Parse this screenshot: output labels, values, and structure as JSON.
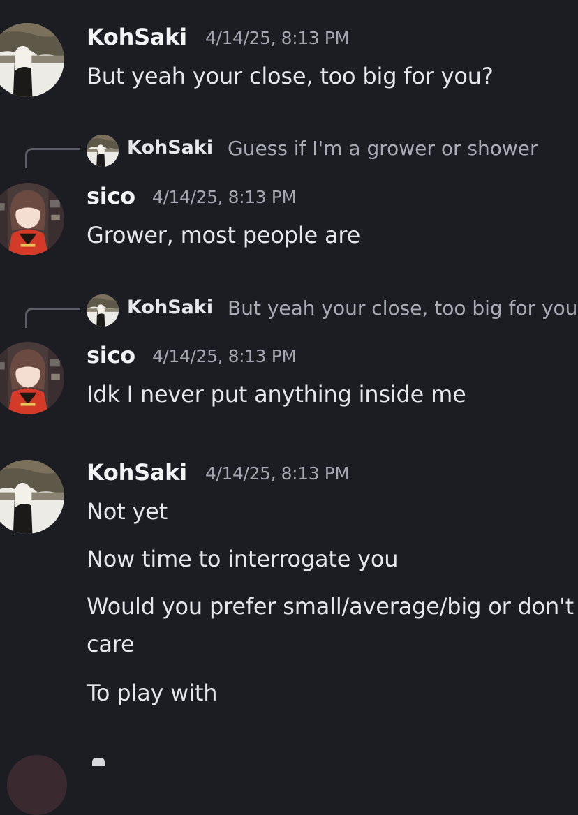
{
  "messages": [
    {
      "author": "KohSaki",
      "timestamp": "4/14/25, 8:13 PM",
      "lines": [
        "But yeah your close, too big for you?"
      ]
    },
    {
      "reply": {
        "author": "KohSaki",
        "text": "Guess if I'm a grower or shower"
      },
      "author": "sico",
      "timestamp": "4/14/25, 8:13 PM",
      "lines": [
        "Grower, most people are"
      ]
    },
    {
      "reply": {
        "author": "KohSaki",
        "text": "But yeah your close, too big for you?"
      },
      "author": "sico",
      "timestamp": "4/14/25, 8:13 PM",
      "lines": [
        "Idk I never put anything inside me"
      ]
    },
    {
      "author": "KohSaki",
      "timestamp": "4/14/25, 8:13 PM",
      "lines": [
        "Not yet",
        "Now time to interrogate you",
        "Would you prefer small/average/big or don't care",
        "To play with"
      ]
    }
  ],
  "colors": {
    "background": "#1c1c23",
    "username": "#f2f3f5",
    "timestamp": "#a5a8b2",
    "message_text": "#e6e7ea",
    "reply_text": "#a9acb6"
  },
  "icons": {
    "kohsaki_avatar": "avatar-kohsaki-icon",
    "sico_avatar": "avatar-sico-icon"
  }
}
